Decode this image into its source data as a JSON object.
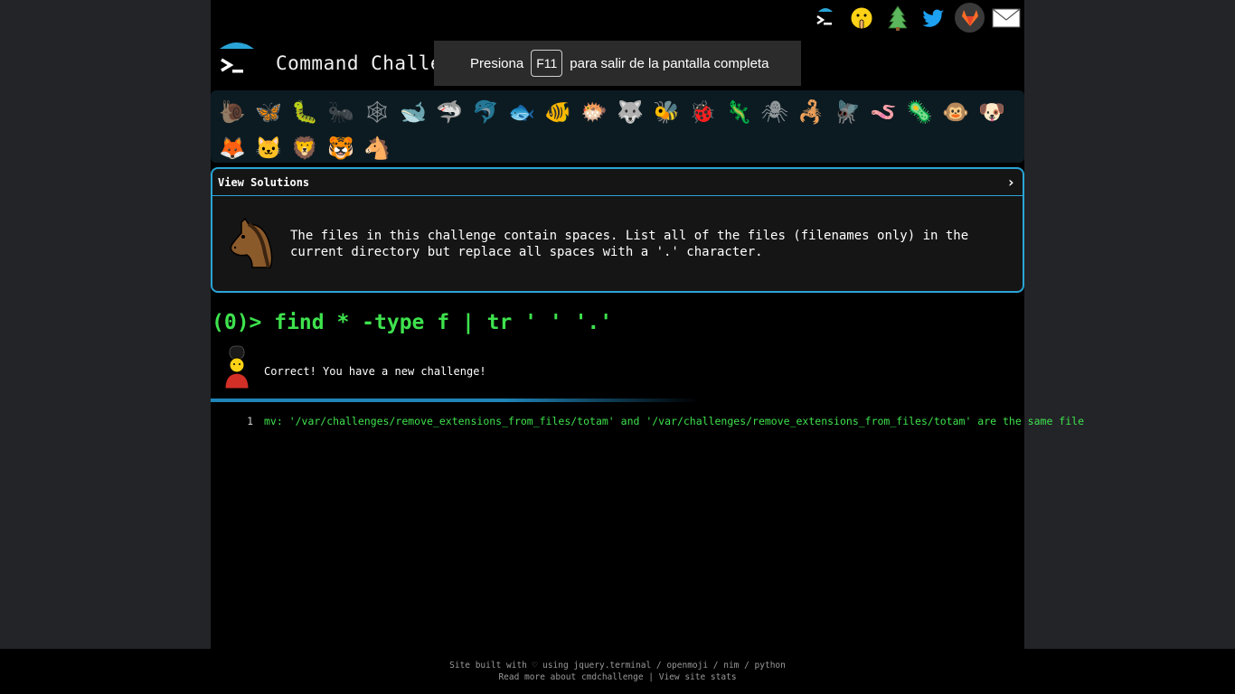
{
  "header": {
    "title": "Command Challenge"
  },
  "social": [
    {
      "name": "cmdchallenge-icon"
    },
    {
      "name": "shush-face-icon"
    },
    {
      "name": "tree-icon"
    },
    {
      "name": "twitter-icon"
    },
    {
      "name": "gitlab-icon"
    },
    {
      "name": "mail-icon"
    }
  ],
  "toast": {
    "prefix": "Presiona",
    "key": "F11",
    "suffix": "para salir de la pantalla completa"
  },
  "animals": [
    {
      "glyph": "🐌",
      "name": "snail",
      "dim": true
    },
    {
      "glyph": "🦋",
      "name": "butterfly"
    },
    {
      "glyph": "🐛",
      "name": "bug"
    },
    {
      "glyph": "🐜",
      "name": "ant",
      "dim": true
    },
    {
      "glyph": "🕸",
      "name": "web",
      "dim": true
    },
    {
      "glyph": "🐋",
      "name": "whale"
    },
    {
      "glyph": "🦈",
      "name": "shark"
    },
    {
      "glyph": "🐬",
      "name": "dolphin",
      "dim": true
    },
    {
      "glyph": "🐟",
      "name": "fish"
    },
    {
      "glyph": "🐠",
      "name": "tropical-fish"
    },
    {
      "glyph": "🐡",
      "name": "blowfish"
    },
    {
      "glyph": "🐺",
      "name": "wolf"
    },
    {
      "glyph": "🐝",
      "name": "bee"
    },
    {
      "glyph": "🐞",
      "name": "ladybug"
    },
    {
      "glyph": "🦎",
      "name": "lizard"
    },
    {
      "glyph": "🕷",
      "name": "spider",
      "dim": true
    },
    {
      "glyph": "🦂",
      "name": "scorpion"
    },
    {
      "glyph": "🪰",
      "name": "fly"
    },
    {
      "glyph": "🪱",
      "name": "worm"
    },
    {
      "glyph": "🦠",
      "name": "microbe"
    },
    {
      "glyph": "🐵",
      "name": "monkey"
    },
    {
      "glyph": "🐶",
      "name": "dog"
    },
    {
      "glyph": "🦊",
      "name": "fox"
    },
    {
      "glyph": "🐱",
      "name": "cat"
    },
    {
      "glyph": "🦁",
      "name": "lion"
    },
    {
      "glyph": "🐯",
      "name": "tiger"
    },
    {
      "glyph": "🐴",
      "name": "horse"
    }
  ],
  "panel": {
    "heading": "View Solutions",
    "description": "The files in this challenge contain spaces. List all of the files (filenames only) in the current directory but replace all spaces with a '.' character."
  },
  "terminal": {
    "command": "(0)> find * -type f | tr ' ' '.'",
    "result": "Correct! You have a new challenge!",
    "output_lines": [
      {
        "num": "1",
        "text": "mv: '/var/challenges/remove_extensions_from_files/totam' and '/var/challenges/remove_extensions_from_files/totam' are the same file"
      }
    ]
  },
  "footer": {
    "line1": "Site built with ♡ using jquery.terminal / openmoji / nim / python",
    "line2": "Read more about cmdchallenge | View site stats"
  },
  "colors": {
    "accent": "#2aa4d6",
    "terminal_green": "#3ee24d",
    "background": "#000000"
  }
}
